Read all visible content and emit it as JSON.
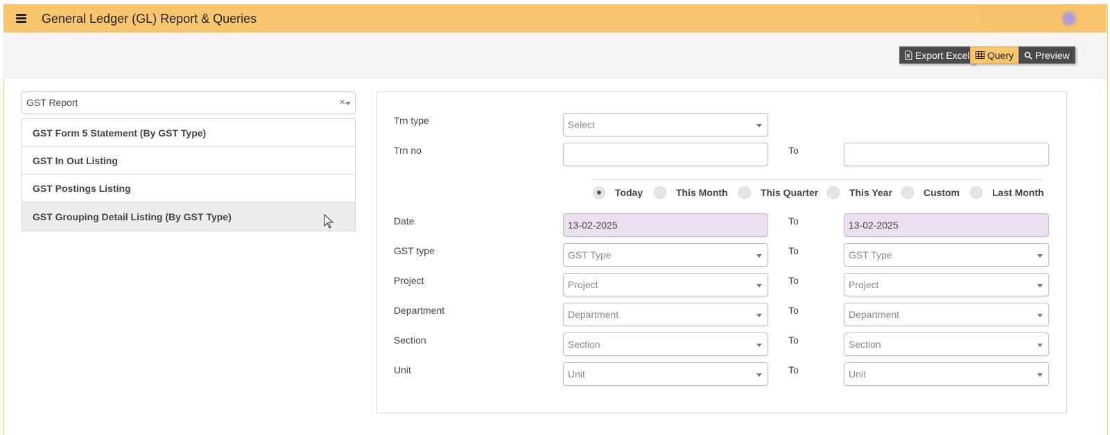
{
  "header": {
    "title": "General Ledger (GL) Report & Queries",
    "accent_color": "#f9c66f",
    "menu_icon": "hamburger-icon"
  },
  "toolbar": {
    "export_label": "Export Excel",
    "export_icon": "excel-file-icon",
    "query_label": "Query",
    "query_icon": "table-icon",
    "preview_label": "Preview",
    "preview_icon": "search-icon"
  },
  "report": {
    "selected": "GST Report",
    "options": [
      "GST Form 5 Statement (By GST Type)",
      "GST In Out Listing",
      "GST Postings Listing",
      "GST Grouping Detail Listing (By GST Type)"
    ]
  },
  "filters": {
    "to_label": "To",
    "trn_type": {
      "label": "Trn type",
      "placeholder": "Select"
    },
    "trn_no": {
      "label": "Trn no",
      "from": "",
      "to": ""
    },
    "date_ranges": {
      "selected": "Today",
      "options": [
        "Today",
        "This Month",
        "This Quarter",
        "This Year",
        "Custom",
        "Last Month"
      ]
    },
    "date": {
      "label": "Date",
      "from": "13-02-2025",
      "to": "13-02-2025"
    },
    "gst_type": {
      "label": "GST type",
      "placeholder": "GST Type"
    },
    "project": {
      "label": "Project",
      "placeholder": "Project"
    },
    "department": {
      "label": "Department",
      "placeholder": "Department"
    },
    "section": {
      "label": "Section",
      "placeholder": "Section"
    },
    "unit": {
      "label": "Unit",
      "placeholder": "Unit"
    }
  }
}
